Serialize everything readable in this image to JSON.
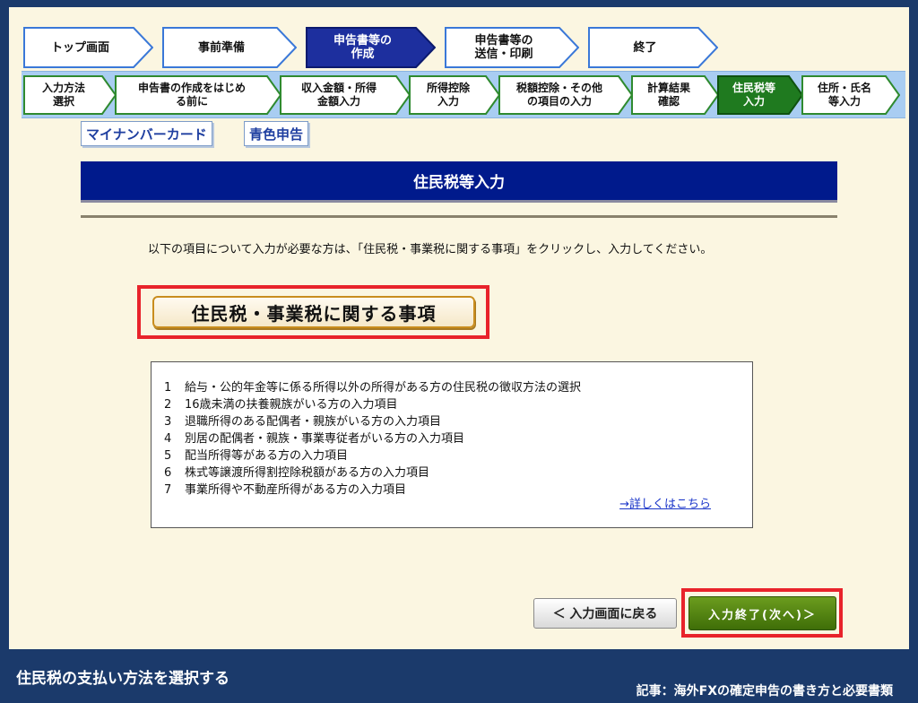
{
  "steps_top": [
    {
      "label": "トップ画面",
      "active": false
    },
    {
      "label": "事前準備",
      "active": false
    },
    {
      "label": "申告書等の\n作成",
      "active": true
    },
    {
      "label": "申告書等の\n送信・印刷",
      "active": false
    },
    {
      "label": "終了",
      "active": false
    }
  ],
  "steps_sub": [
    {
      "label": "入力方法\n選択",
      "active": false
    },
    {
      "label": "申告書の作成をはじめ\nる前に",
      "active": false
    },
    {
      "label": "収入金額・所得\n金額入力",
      "active": false
    },
    {
      "label": "所得控除\n入力",
      "active": false
    },
    {
      "label": "税額控除・その他\nの項目の入力",
      "active": false
    },
    {
      "label": "計算結果\n確認",
      "active": false
    },
    {
      "label": "住民税等\n入力",
      "active": true
    },
    {
      "label": "住所・氏名\n等入力",
      "active": false
    }
  ],
  "tabs": {
    "mynumber": "マイナンバーカード",
    "blue": "青色申告"
  },
  "page_title": "住民税等入力",
  "instruction": "以下の項目について入力が必要な方は、「住民税・事業税に関する事項」をクリックし、入力してください。",
  "matter_button": "住民税・事業税に関する事項",
  "list_items": [
    {
      "n": "1",
      "text": "給与・公的年金等に係る所得以外の所得がある方の住民税の徴収方法の選択"
    },
    {
      "n": "2",
      "text": "16歳未満の扶養親族がいる方の入力項目"
    },
    {
      "n": "3",
      "text": "退職所得のある配偶者・親族がいる方の入力項目"
    },
    {
      "n": "4",
      "text": "別居の配偶者・親族・事業専従者がいる方の入力項目"
    },
    {
      "n": "5",
      "text": "配当所得等がある方の入力項目"
    },
    {
      "n": "6",
      "text": "株式等譲渡所得割控除税額がある方の入力項目"
    },
    {
      "n": "7",
      "text": "事業所得や不動産所得がある方の入力項目"
    }
  ],
  "detail_link": "→詳しくはこちら",
  "back_button": "＜ 入力画面に戻る",
  "next_button": "入力終了(次へ)＞",
  "footer": {
    "caption": "住民税の支払い方法を選択する",
    "article": "記事：海外FXの確定申告の書き方と必要書類"
  },
  "colors": {
    "step_inactive_border": "#3a78d8",
    "step_active_fill": "#1d2f9e",
    "sub_inactive_border": "#2f8a2f",
    "sub_active_fill": "#1f7a1f",
    "highlight": "#e8232b",
    "title_bar": "#001a8c"
  }
}
